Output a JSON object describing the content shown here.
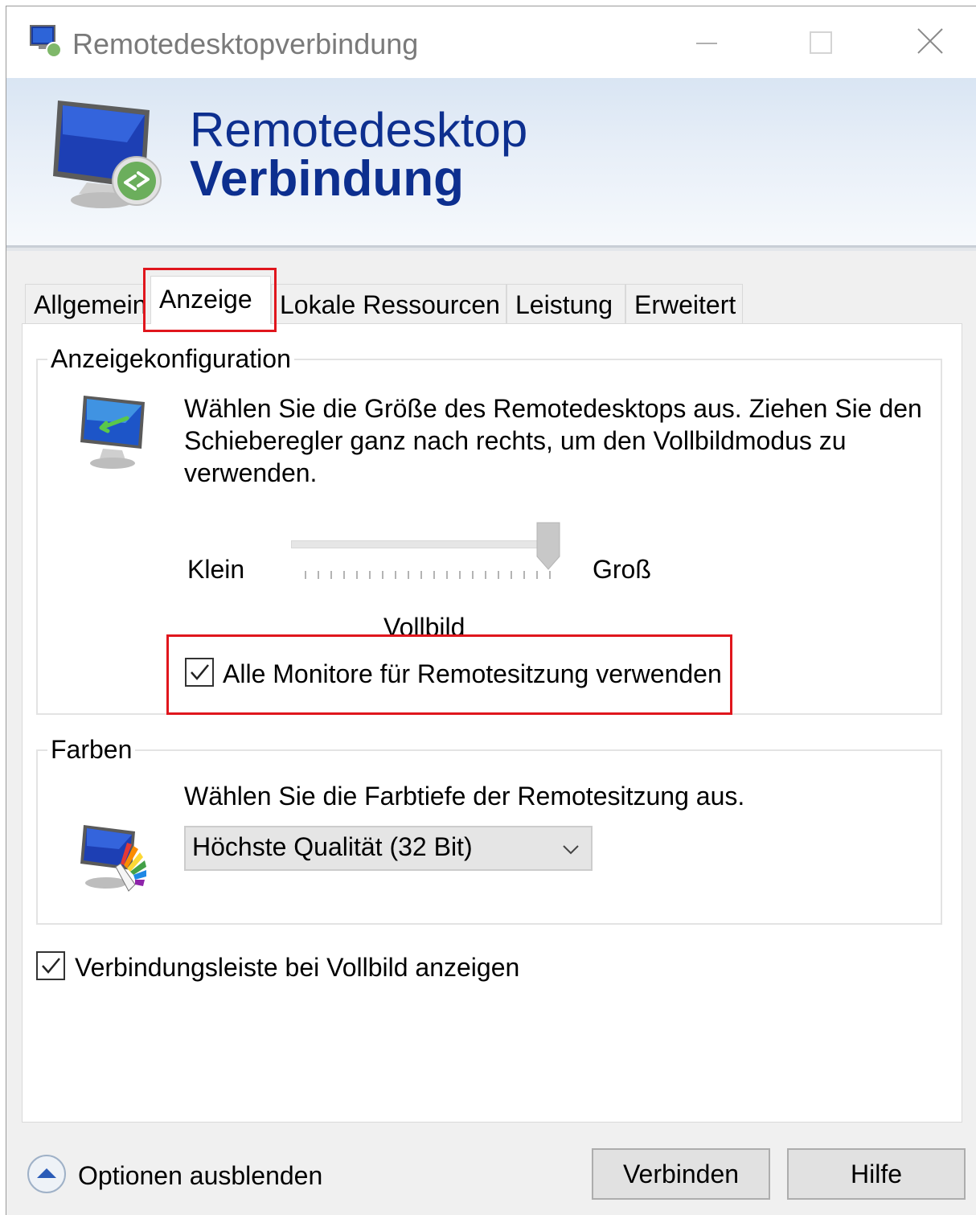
{
  "window": {
    "title": "Remotedesktopverbindung"
  },
  "banner": {
    "line1": "Remotedesktop",
    "line2": "Verbindung"
  },
  "tabs": [
    {
      "label": "Allgemein",
      "active": false
    },
    {
      "label": "Anzeige",
      "active": true
    },
    {
      "label": "Lokale Ressourcen",
      "active": false
    },
    {
      "label": "Leistung",
      "active": false
    },
    {
      "label": "Erweitert",
      "active": false
    }
  ],
  "display_config": {
    "group_label": "Anzeigekonfiguration",
    "description": "Wählen Sie die Größe des Remotedesktops aus. Ziehen Sie den Schieberegler ganz nach rechts, um den Vollbildmodus zu verwenden.",
    "slider_min_label": "Klein",
    "slider_max_label": "Groß",
    "slider_value_label": "Vollbild",
    "slider_position": "max",
    "all_monitors_label": "Alle Monitore für Remotesitzung verwenden",
    "all_monitors_checked": true
  },
  "colors": {
    "group_label": "Farben",
    "description": "Wählen Sie die Farbtiefe der Remotesitzung aus.",
    "selected": "Höchste Qualität (32 Bit)"
  },
  "connection_bar": {
    "label": "Verbindungsleiste bei Vollbild anzeigen",
    "checked": true
  },
  "footer": {
    "options_label": "Optionen ausblenden",
    "connect_label": "Verbinden",
    "help_label": "Hilfe"
  },
  "theme": {
    "accent": "#0d2f8f",
    "highlight": "#e0161d"
  }
}
